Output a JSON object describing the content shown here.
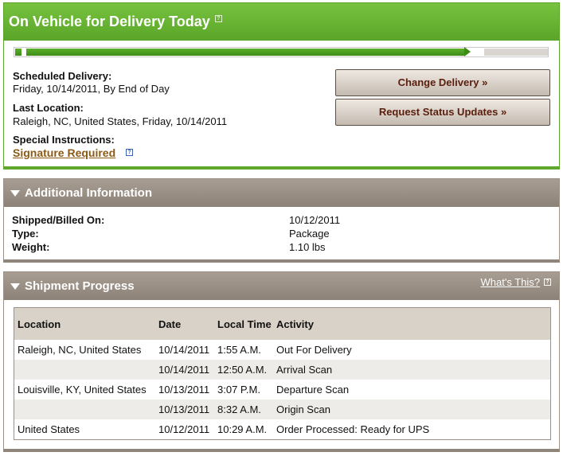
{
  "status": {
    "title": "On Vehicle for Delivery Today",
    "help_glyph": "?",
    "progress": 0.85,
    "colors": {
      "header": "#66b232",
      "progress": "#3d8c18",
      "accent_link": "#8b5a14"
    },
    "scheduled_label": "Scheduled Delivery:",
    "scheduled_value": "Friday, 10/14/2011, By End of Day",
    "location_label": "Last Location:",
    "location_value": "Raleigh, NC, United States, Friday, 10/14/2011",
    "instructions_label": "Special Instructions:",
    "instructions_link": "Signature Required",
    "buttons": {
      "change": "Change Delivery »",
      "request": "Request Status Updates »"
    }
  },
  "additional": {
    "title": "Additional Information",
    "rows": [
      {
        "label": "Shipped/Billed On:",
        "value": "10/12/2011"
      },
      {
        "label": "Type:",
        "value": "Package"
      },
      {
        "label": "Weight:",
        "value": "1.10 lbs"
      }
    ]
  },
  "shipment": {
    "title": "Shipment Progress",
    "whats_this": "What's This?",
    "columns": [
      "Location",
      "Date",
      "Local Time",
      "Activity"
    ],
    "rows": [
      {
        "location": "Raleigh, NC, United States",
        "date": "10/14/2011",
        "time": "1:55 A.M.",
        "activity": "Out For Delivery"
      },
      {
        "location": "",
        "date": "10/14/2011",
        "time": "12:50 A.M.",
        "activity": "Arrival Scan"
      },
      {
        "location": "Louisville, KY, United States",
        "date": "10/13/2011",
        "time": "3:07 P.M.",
        "activity": "Departure Scan"
      },
      {
        "location": "",
        "date": "10/13/2011",
        "time": "8:32 A.M.",
        "activity": "Origin Scan"
      },
      {
        "location": "United States",
        "date": "10/12/2011",
        "time": "10:29 A.M.",
        "activity": "Order Processed: Ready for UPS"
      }
    ]
  }
}
